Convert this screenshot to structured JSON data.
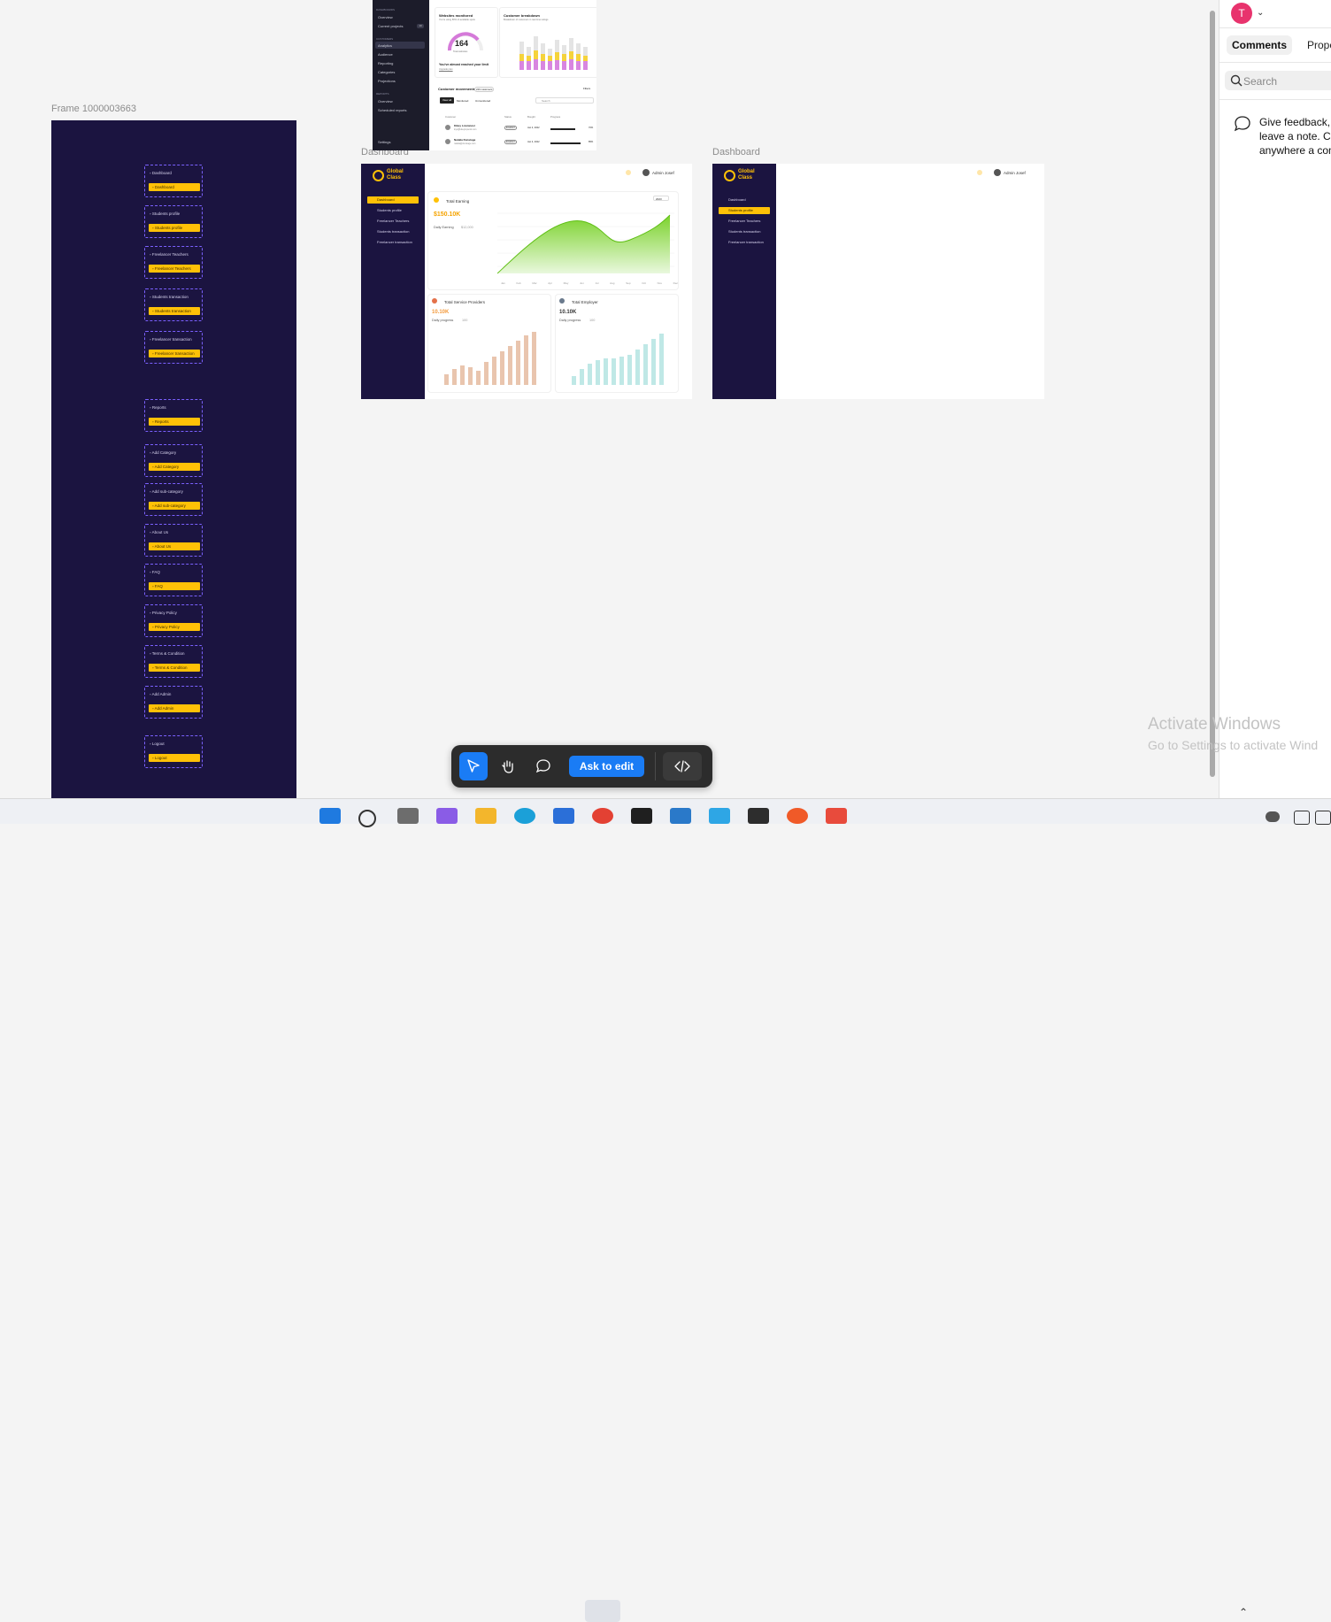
{
  "canvas": {
    "frame_left_label": "Frame 1000003663",
    "dashboard_label_1": "Dashboard",
    "dashboard_label_2": "Dashboard"
  },
  "left_frame": {
    "groups": [
      {
        "label": "Dashboard"
      },
      {
        "label": "Students profile"
      },
      {
        "label": "Freelancer Teachers"
      },
      {
        "label": "Students transaction"
      },
      {
        "label": "Freelancer transaction"
      },
      {
        "label": "Reports"
      },
      {
        "label": "Add Category"
      },
      {
        "label": "Add sub-category"
      },
      {
        "label": "About Us"
      },
      {
        "label": "FAQ"
      },
      {
        "label": "Privacy Policy"
      },
      {
        "label": "Terms & Condition"
      },
      {
        "label": "Add Admin"
      },
      {
        "label": "Logout"
      }
    ]
  },
  "top_frame": {
    "sections": {
      "dashboards": "DASHBOARDS",
      "customers": "CUSTOMERS",
      "reports": "REPORTS"
    },
    "nav": [
      "Overview",
      "Current projects",
      "Analytics",
      "Audience",
      "Reporting",
      "Categories",
      "Projections",
      "Overview",
      "Scheduled reports",
      "Settings"
    ],
    "badge": "10",
    "websites_title": "Websites monitored",
    "websites_sub": "You're using 80% of available spots",
    "gauge_value": "164",
    "gauge_label": "Total websites",
    "websites_note": "You've almost reached your limit",
    "websites_link": "Upgrade plan",
    "breakdown_title": "Customer breakdown",
    "breakdown_sub": "Breakdown of customers in real time ratings",
    "movements_title": "Customer movements",
    "movements_badge": "240 customers",
    "filters": [
      "View all",
      "Monitored",
      "Unmonitored"
    ],
    "filter_button": "Filters",
    "search_placeholder": "Search",
    "table_headers": [
      "Customer",
      "Status",
      "Bought",
      "Progress"
    ],
    "rows": [
      {
        "name": "Kikey Lowrancer",
        "email": "kiyo@kikeylupsock.com",
        "status": "Enabled",
        "date": "Jan 4, 2022",
        "progress": "70%"
      },
      {
        "name": "Natalia Dunstage",
        "email": "natalia@dunstage.com",
        "status": "Enabled",
        "date": "Jan 4, 2022",
        "progress": "85%"
      }
    ]
  },
  "dash1": {
    "logo": [
      "Global",
      "Class"
    ],
    "nav": [
      "Dashboard",
      "Students profile",
      "Freelancer Teachers",
      "Students transaction",
      "Freelancer transaction"
    ],
    "user": "Admin Josef",
    "earning_title": "Total Earning",
    "earning_value": "$150.10K",
    "daily_label": "Daily Earning",
    "daily_value": "$12,000",
    "period": "2023",
    "months": [
      "Jan",
      "Feb",
      "Mar",
      "Apr",
      "May",
      "Jun",
      "Jul",
      "Aug",
      "Sep",
      "Oct",
      "Nov",
      "Dec"
    ],
    "sp_title": "Total Service Providers",
    "sp_value": "10.10K",
    "sp_progress_label": "Daily progress",
    "sp_progress": "100",
    "emp_title": "Total Employer",
    "emp_value": "10.10K",
    "emp_progress_label": "Daily progress",
    "emp_progress": "100"
  },
  "dash2": {
    "logo": [
      "Global",
      "Class"
    ],
    "nav": [
      "Dashboard",
      "Students profile",
      "Freelancer Teachers",
      "Students transaction",
      "Freelancer transaction"
    ],
    "user": "Admin Josef"
  },
  "panel": {
    "avatar_letter": "T",
    "tab_comments": "Comments",
    "tab_properties": "Prope",
    "search_placeholder": "Search",
    "feedback": "Give feedback, just leave a note. Click anywhere a comment."
  },
  "toolbar": {
    "ask_edit": "Ask to edit",
    "active_tool": "move"
  },
  "watermark": {
    "line1": "Activate Windows",
    "line2": "Go to Settings to activate Wind"
  },
  "colors": {
    "sidebar": "#1b1440",
    "accent": "#ffc107",
    "primary_blue": "#1a7cf5",
    "avatar": "#e8336d"
  }
}
